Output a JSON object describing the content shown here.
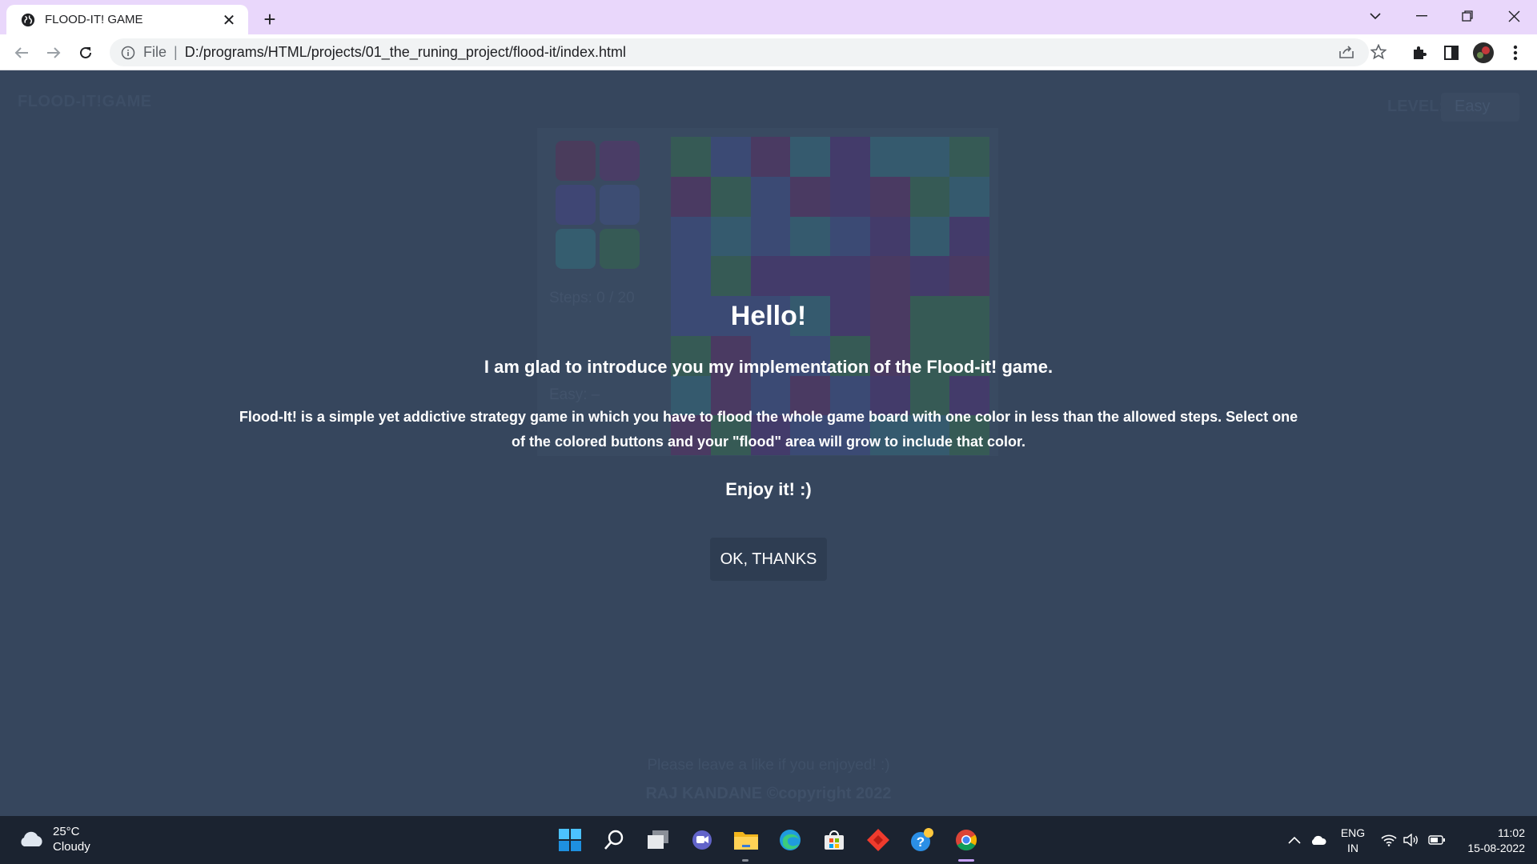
{
  "browser": {
    "tab_title": "FLOOD-IT! GAME",
    "url_scheme": "File",
    "url": "D:/programs/HTML/projects/01_the_runing_project/flood-it/index.html"
  },
  "page": {
    "game_title": "FLOOD-IT!GAME",
    "level_label": "LEVEL:",
    "level_value": "Easy",
    "steps": "Steps: 0 / 20",
    "best_score": "Easy: –",
    "footer_like": "Please leave a like if you enjoyed! :)",
    "footer_copyright": "RAJ KANDANE ©copyright 2022",
    "board_colors": [
      "#365a55",
      "#3b4a74",
      "#4a3a62",
      "#355a6e",
      "#433b6a"
    ]
  },
  "modal": {
    "hello": "Hello!",
    "intro": "I am glad to introduce you my implementation of the Flood-it! game.",
    "description": "Flood-It! is a simple yet addictive strategy game in which you have to flood the whole game board with one color in less than the allowed steps. Select one of the colored buttons and your \"flood\" area will grow to include that color.",
    "enjoy": "Enjoy it! :)",
    "ok_button": "OK, THANKS"
  },
  "taskbar": {
    "weather_temp": "25°C",
    "weather_desc": "Cloudy",
    "lang_1": "ENG",
    "lang_2": "IN",
    "time": "11:02",
    "date": "15-08-2022",
    "apps": [
      "windows-start-icon",
      "search-icon",
      "task-view-icon",
      "teams-chat-icon",
      "file-explorer-icon",
      "edge-icon",
      "microsoft-store-icon",
      "anydesk-icon",
      "get-help-icon",
      "chrome-icon"
    ]
  }
}
